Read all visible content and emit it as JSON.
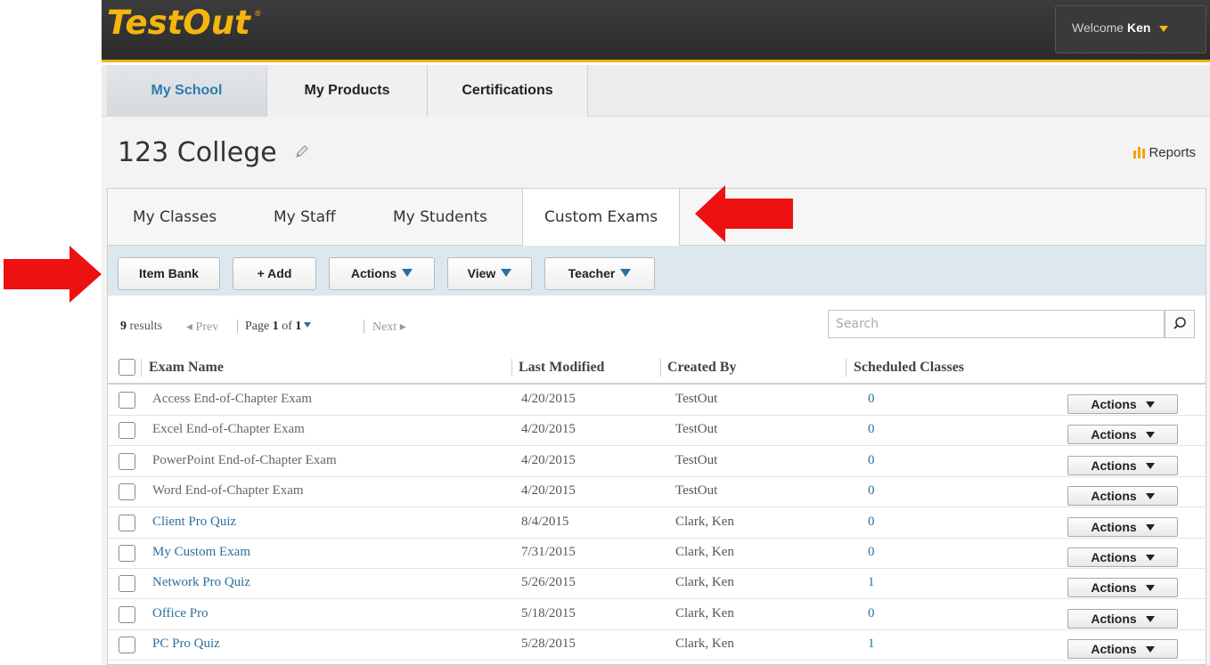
{
  "header": {
    "logo_text": "TestOut",
    "logo_reg": "®",
    "welcome_prefix": "Welcome",
    "user_name": "Ken",
    "brand_color": "#f5b50f"
  },
  "main_nav": [
    {
      "label": "My School",
      "active": true
    },
    {
      "label": "My Products",
      "active": false
    },
    {
      "label": "Certifications",
      "active": false
    }
  ],
  "page": {
    "title": "123 College",
    "reports_label": "Reports"
  },
  "sub_tabs": [
    {
      "label": "My Classes",
      "active": false
    },
    {
      "label": "My Staff",
      "active": false
    },
    {
      "label": "My Students",
      "active": false
    },
    {
      "label": "Custom Exams",
      "active": true
    }
  ],
  "toolbar": {
    "item_bank": "Item Bank",
    "add": "+ Add",
    "actions": "Actions",
    "view": "View",
    "teacher": "Teacher"
  },
  "pagination": {
    "results_count": "9",
    "results_label": "results",
    "prev": "◂ Prev",
    "page_prefix": "Page",
    "current_page": "1",
    "of": "of",
    "total_pages": "1",
    "next": "Next ▸"
  },
  "search": {
    "placeholder": "Search"
  },
  "table": {
    "columns": [
      "Exam Name",
      "Last Modified",
      "Created By",
      "Scheduled Classes"
    ],
    "row_action_label": "Actions",
    "rows": [
      {
        "name": "Access End-of-Chapter Exam",
        "modified": "4/20/2015",
        "created_by": "TestOut",
        "scheduled": "0",
        "is_link": false
      },
      {
        "name": "Excel End-of-Chapter Exam",
        "modified": "4/20/2015",
        "created_by": "TestOut",
        "scheduled": "0",
        "is_link": false
      },
      {
        "name": "PowerPoint End-of-Chapter Exam",
        "modified": "4/20/2015",
        "created_by": "TestOut",
        "scheduled": "0",
        "is_link": false
      },
      {
        "name": "Word End-of-Chapter Exam",
        "modified": "4/20/2015",
        "created_by": "TestOut",
        "scheduled": "0",
        "is_link": false
      },
      {
        "name": "Client Pro Quiz",
        "modified": "8/4/2015",
        "created_by": "Clark, Ken",
        "scheduled": "0",
        "is_link": true
      },
      {
        "name": "My Custom Exam",
        "modified": "7/31/2015",
        "created_by": "Clark, Ken",
        "scheduled": "0",
        "is_link": true
      },
      {
        "name": "Network Pro Quiz",
        "modified": "5/26/2015",
        "created_by": "Clark, Ken",
        "scheduled": "1",
        "is_link": true
      },
      {
        "name": "Office Pro",
        "modified": "5/18/2015",
        "created_by": "Clark, Ken",
        "scheduled": "0",
        "is_link": true
      },
      {
        "name": "PC Pro Quiz",
        "modified": "5/28/2015",
        "created_by": "Clark, Ken",
        "scheduled": "1",
        "is_link": true
      }
    ]
  },
  "annotation_color": "#ee1111"
}
